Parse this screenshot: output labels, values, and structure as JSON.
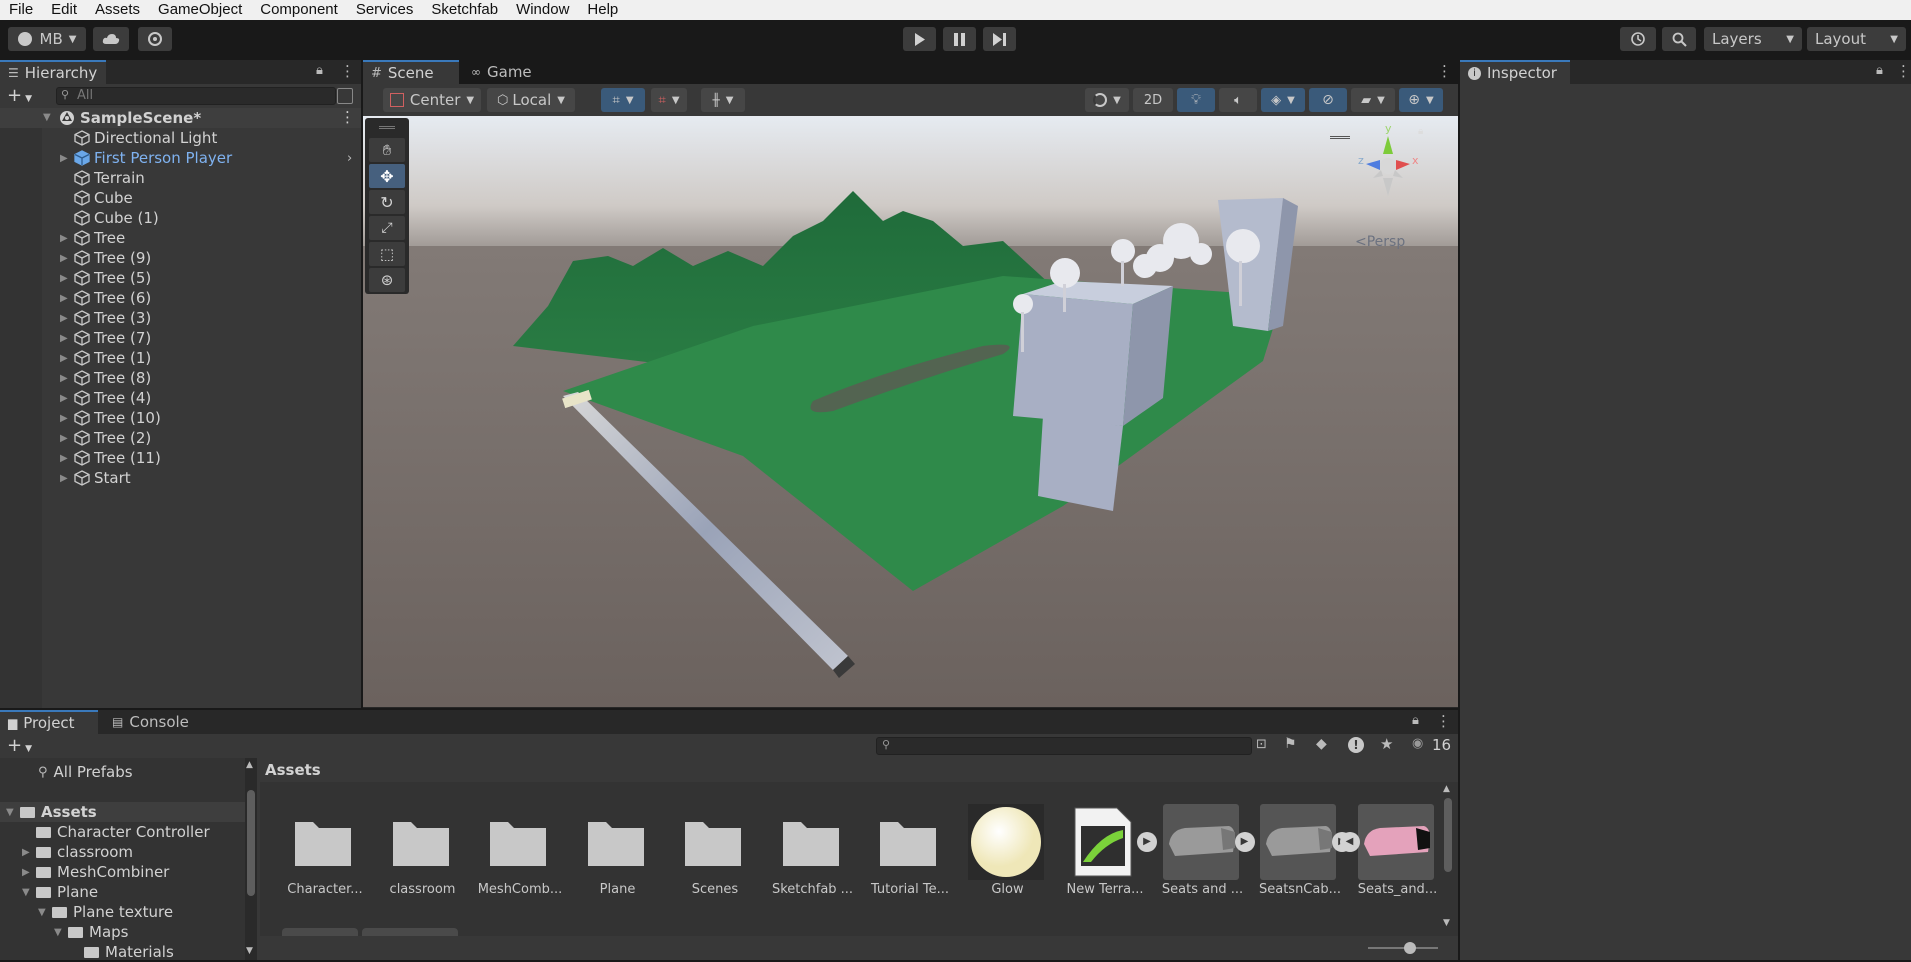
{
  "menu": [
    "File",
    "Edit",
    "Assets",
    "GameObject",
    "Component",
    "Services",
    "Sketchfab",
    "Window",
    "Help"
  ],
  "toolbar": {
    "account": "MB",
    "layers": "Layers",
    "layout": "Layout"
  },
  "hierarchy": {
    "tab": "Hierarchy",
    "search_placeholder": "All",
    "scene": "SampleScene*",
    "items": [
      {
        "label": "Directional Light",
        "expandable": false,
        "selected": false
      },
      {
        "label": "First Person Player",
        "expandable": true,
        "selected": true
      },
      {
        "label": "Terrain",
        "expandable": false,
        "selected": false
      },
      {
        "label": "Cube",
        "expandable": false,
        "selected": false
      },
      {
        "label": "Cube (1)",
        "expandable": false,
        "selected": false
      },
      {
        "label": "Tree",
        "expandable": true,
        "selected": false
      },
      {
        "label": "Tree (9)",
        "expandable": true,
        "selected": false
      },
      {
        "label": "Tree (5)",
        "expandable": true,
        "selected": false
      },
      {
        "label": "Tree (6)",
        "expandable": true,
        "selected": false
      },
      {
        "label": "Tree (3)",
        "expandable": true,
        "selected": false
      },
      {
        "label": "Tree (7)",
        "expandable": true,
        "selected": false
      },
      {
        "label": "Tree (1)",
        "expandable": true,
        "selected": false
      },
      {
        "label": "Tree (8)",
        "expandable": true,
        "selected": false
      },
      {
        "label": "Tree (4)",
        "expandable": true,
        "selected": false
      },
      {
        "label": "Tree (10)",
        "expandable": true,
        "selected": false
      },
      {
        "label": "Tree (2)",
        "expandable": true,
        "selected": false
      },
      {
        "label": "Tree (11)",
        "expandable": true,
        "selected": false
      },
      {
        "label": "Start",
        "expandable": true,
        "selected": false
      }
    ]
  },
  "scene_tabs": {
    "scene": "Scene",
    "game": "Game"
  },
  "scene_toolbar": {
    "pivot": "Center",
    "space": "Local",
    "mode_2d": "2D"
  },
  "gizmo": {
    "projection": "Persp",
    "axis_x": "x",
    "axis_y": "y",
    "axis_z": "z"
  },
  "inspector": {
    "tab": "Inspector"
  },
  "project": {
    "tab_project": "Project",
    "tab_console": "Console",
    "hidden_count": "16",
    "breadcrumb": "Assets",
    "favorites": "All Prefabs",
    "tree": [
      {
        "label": "Assets",
        "level": 0,
        "state": "open",
        "bold": true
      },
      {
        "label": "Character Controller",
        "level": 1,
        "state": "none",
        "bold": false
      },
      {
        "label": "classroom",
        "level": 1,
        "state": "closed",
        "bold": false
      },
      {
        "label": "MeshCombiner",
        "level": 1,
        "state": "closed",
        "bold": false
      },
      {
        "label": "Plane",
        "level": 1,
        "state": "open",
        "bold": false
      },
      {
        "label": "Plane texture",
        "level": 2,
        "state": "open",
        "bold": false
      },
      {
        "label": "Maps",
        "level": 3,
        "state": "open",
        "bold": false
      },
      {
        "label": "Materials",
        "level": 4,
        "state": "none",
        "bold": false
      }
    ],
    "assets": [
      {
        "label": "Character...",
        "kind": "folder"
      },
      {
        "label": "classroom",
        "kind": "folder"
      },
      {
        "label": "MeshComb...",
        "kind": "folder"
      },
      {
        "label": "Plane",
        "kind": "folder"
      },
      {
        "label": "Scenes",
        "kind": "folder"
      },
      {
        "label": "Sketchfab ...",
        "kind": "folder"
      },
      {
        "label": "Tutorial Te...",
        "kind": "folder"
      },
      {
        "label": "Glow",
        "kind": "material"
      },
      {
        "label": "New Terra...",
        "kind": "terrain"
      },
      {
        "label": "Seats and ...",
        "kind": "model"
      },
      {
        "label": "SeatsnCab...",
        "kind": "model"
      },
      {
        "label": "Seats_and...",
        "kind": "model-pink"
      }
    ]
  },
  "colors": {
    "accent": "#3a79bb",
    "selected_text": "#7fb2f0",
    "terrain": "#2f8a4a",
    "ground": "#6e6560",
    "sky": "#e8ecf0"
  }
}
